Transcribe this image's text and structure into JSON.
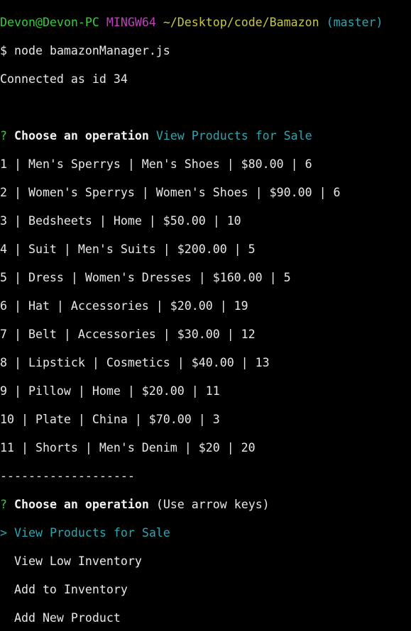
{
  "colors": {
    "background": "#000000",
    "text": "#e8e8e8",
    "prompt_user": "#2fcf37",
    "prompt_shell": "#c43cc4",
    "prompt_path": "#c8c83a",
    "branch": "#2aa7b0",
    "question_mark": "#2fcf37",
    "selection": "#2aa7b0"
  },
  "prompt": {
    "user_host": "Devon@Devon-PC",
    "shell": "MINGW64",
    "path": "~/Desktop/code/Bamazon",
    "branch": "(master)",
    "symbol": "$",
    "command": "node bamazonManager.js"
  },
  "connection_message": "Connected as id 34",
  "first_question": {
    "marker": "?",
    "label": "Choose an operation",
    "answer": "View Products for Sale"
  },
  "products": [
    "1 | Men's Sperrys | Men's Shoes | $80.00 | 6",
    "2 | Women's Sperrys | Women's Shoes | $90.00 | 6",
    "3 | Bedsheets | Home | $50.00 | 10",
    "4 | Suit | Men's Suits | $200.00 | 5",
    "5 | Dress | Women's Dresses | $160.00 | 5",
    "6 | Hat | Accessories | $20.00 | 19",
    "7 | Belt | Accessories | $30.00 | 12",
    "8 | Lipstick | Cosmetics | $40.00 | 13",
    "9 | Pillow | Home | $20.00 | 11",
    "10 | Plate | China | $70.00 | 3",
    "11 | Shorts | Men's Denim | $20 | 20"
  ],
  "separator": "-------------------",
  "second_question": {
    "marker": "?",
    "label": "Choose an operation",
    "hint": "(Use arrow keys)"
  },
  "menu": {
    "pointer": ">",
    "options": [
      "View Products for Sale",
      "View Low Inventory",
      "Add to Inventory",
      "Add New Product"
    ],
    "selected_index": 0
  }
}
